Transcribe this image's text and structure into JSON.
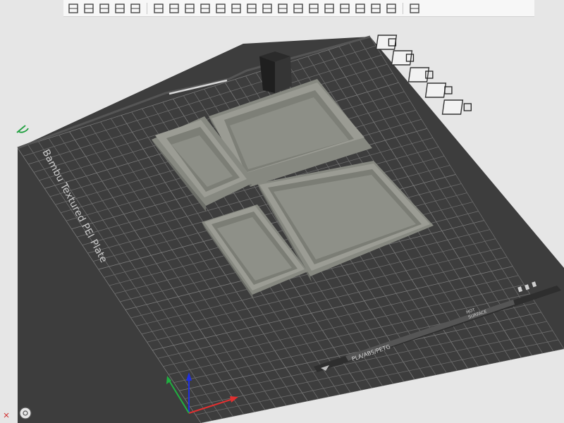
{
  "plate": {
    "name": "Bambu Textured PEI Plate",
    "filament_label": "PLA/ABS/PETG",
    "surface_label_line1": "HOT",
    "surface_label_line2": "SURFACE"
  },
  "toolbar": {
    "groups": [
      [
        "add-object-icon",
        "add-plate-icon",
        "auto-orient-icon",
        "arrange-icon",
        "menu-lines-icon"
      ],
      [
        "move-icon",
        "rotate-icon",
        "scale-icon",
        "lay-on-face-icon",
        "cut-icon",
        "boolean-icon",
        "support-paint-icon",
        "seam-paint-icon",
        "text-icon",
        "mesh-boolean-icon",
        "assembly-icon",
        "split-objects-icon",
        "split-parts-icon",
        "variable-height-icon",
        "measure-icon",
        "ruler-icon"
      ],
      [
        "view-settings-icon"
      ]
    ]
  },
  "side_tools": [
    "close-plate-icon",
    "orient-plate-icon",
    "arrange-plate-icon",
    "lock-plate-icon",
    "plate-settings-icon"
  ],
  "colors": {
    "plate": "#3e3e3e",
    "grid": "#6a6a6a",
    "bin": "#8f918a",
    "axis_x": "#e03030",
    "axis_y": "#20b040",
    "axis_z": "#2030e0"
  }
}
